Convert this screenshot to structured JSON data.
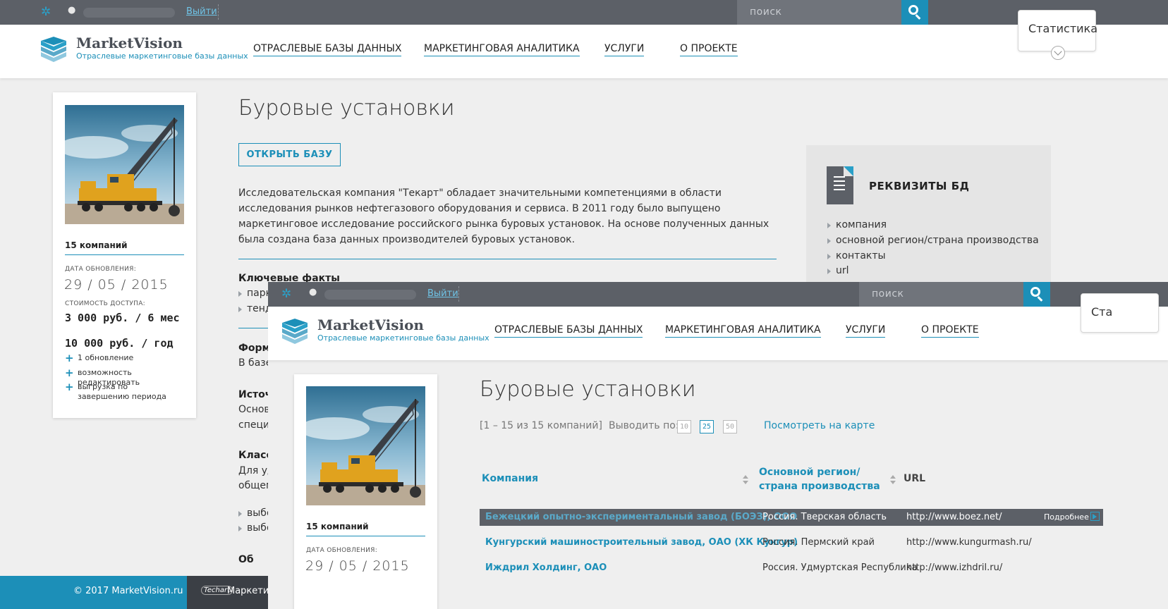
{
  "topbar": {
    "logout": "Выйти",
    "search_placeholder": "поиск"
  },
  "brand": {
    "title": "MarketVision",
    "subtitle": "Отраслевые маркетинговые базы данных"
  },
  "nav": [
    "ОТРАСЛЕВЫЕ БАЗЫ ДАННЫХ",
    "МАРКЕТИНГОВАЯ АНАЛИТИКА",
    "УСЛУГИ",
    "О ПРОЕКТЕ"
  ],
  "stats_tab": {
    "label": "Статистика",
    "overlay_label": "Ста"
  },
  "card": {
    "count": "15 компаний",
    "updated_label": "ДАТА ОБНОВЛЕНИЯ:",
    "updated_value": "29 / 05 / 2015",
    "cost_label": "СТОИМОСТЬ ДОСТУПА:",
    "price_1": "3 000 руб. / 6 мес",
    "price_2": "10 000 руб. / год",
    "features": [
      "1 обновление",
      "возможность редактировать",
      "выгрузка по завершению периода"
    ]
  },
  "page": {
    "title": "Буровые установки",
    "open_button": "ОТКРЫТЬ БАЗУ",
    "description": "Исследовательская компания \"Текарт\" обладает значительными компетенциями в области исследования рынков нефтегазового оборудования и сервиса. В 2011 году было выпущено маркетинговое исследование российского рынка буровых установок. На основе полученных данных была создана база данных производителей буровых установок.",
    "key_facts_title": "Ключевые факты",
    "key_facts_items": [
      "парк",
      "тенд"
    ],
    "section_formed": "Форм",
    "section_formed_text": "В базе",
    "section_sources": "Источ",
    "section_sources_text_1": "Основ",
    "section_sources_text_2": "специ",
    "section_class": "Класс",
    "section_class_text_1": "Для уд",
    "section_class_text_2": "общем",
    "class_items": [
      "выбо",
      "выбо"
    ],
    "cut_heading": "Об"
  },
  "requisites": {
    "title": "РЕКВИЗИТЫ БД",
    "items": [
      "компания",
      "основной регион/страна производства",
      "контакты",
      "url"
    ]
  },
  "footer": {
    "copyright": "© 2017 MarketVision.ru",
    "partner_logo": "Techart",
    "partner_text": "Маркетин"
  },
  "listing": {
    "range": "[1 – 15 из 15 компаний]",
    "per_page_label": "Выводить по:",
    "per_page_options": [
      "10",
      "25",
      "50"
    ],
    "per_page_active": "25",
    "map_link": "Посмотреть на карте",
    "columns": {
      "company": "Компания",
      "region": "Основной регион/страна производства",
      "url": "URL"
    },
    "rows": [
      {
        "company": "Бежецкий опытно-экспериментальный завод (БОЭЗ), ООО",
        "region": "Россия. Тверская область",
        "url": "http://www.boez.net/",
        "more": "Подробнее"
      },
      {
        "company": "Кунгурский машиностроительный завод, ОАО (ХК Кунгур)",
        "region": "Россия. Пермский край",
        "url": "http://www.kungurmash.ru/"
      },
      {
        "company": "Иждрил Холдинг, ОАО",
        "region": "Россия. Удмуртская Республика",
        "url": "http://www.izhdril.ru/"
      }
    ]
  },
  "colors": {
    "accent": "#1c8fb8",
    "topbar": "#5c6067",
    "background": "#efefef"
  }
}
